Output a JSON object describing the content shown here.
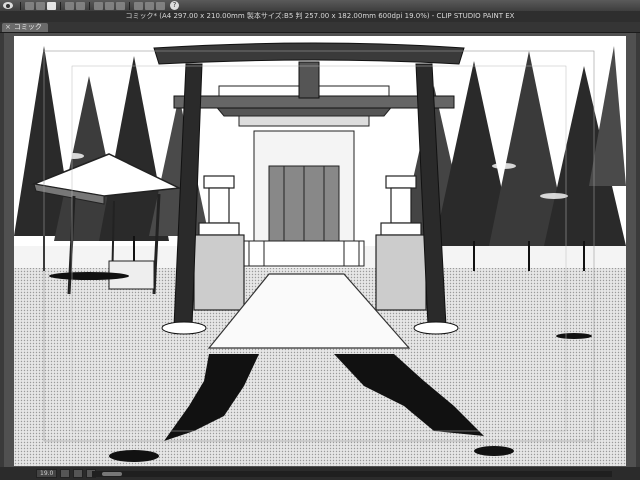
{
  "window": {
    "title": "コミック* (A4 297.00 x 210.00mm 製本サイズ:B5 判 257.00 x 182.00mm 600dpi 19.0%) - CLIP STUDIO PAINT EX"
  },
  "tabs": [
    {
      "label": "コミック"
    }
  ],
  "status": {
    "zoom": "19.0"
  }
}
